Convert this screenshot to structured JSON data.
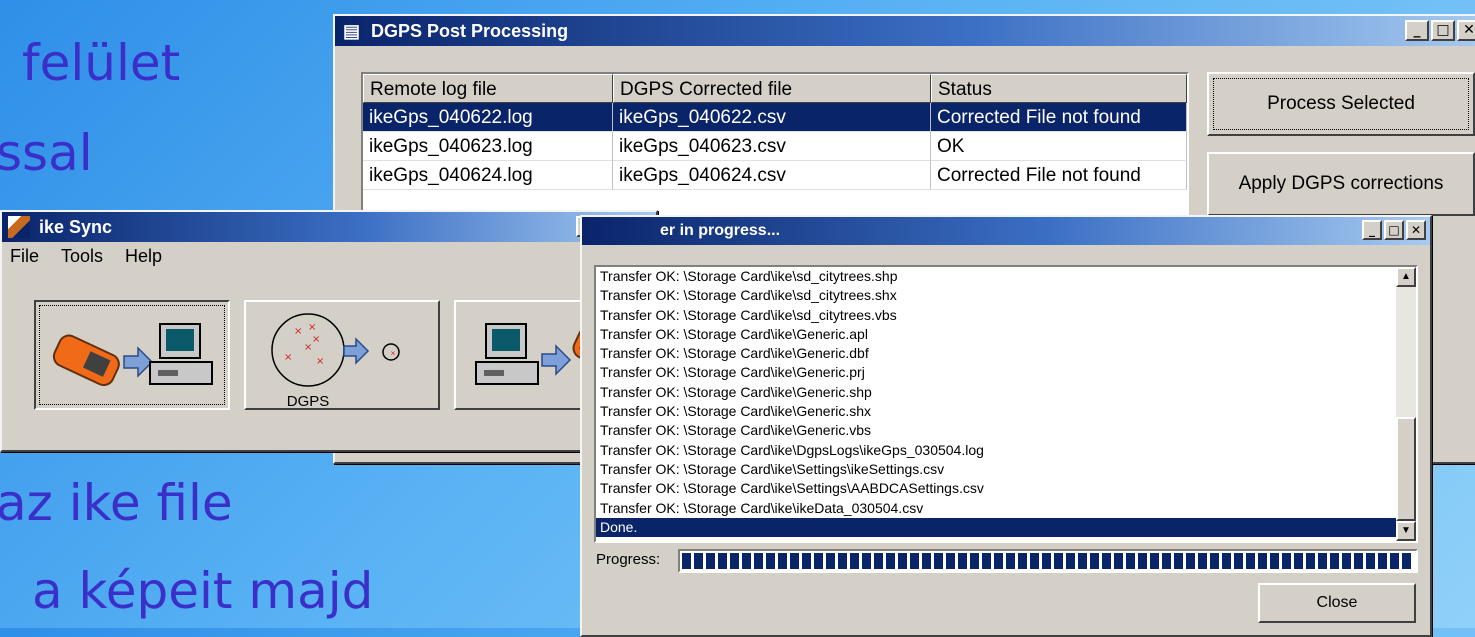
{
  "slide": {
    "line1": "felület",
    "line2": "ssal",
    "line3": "az ike file",
    "line4": "a képeit majd"
  },
  "dgps_window": {
    "title": "DGPS Post Processing",
    "columns": [
      "Remote log file",
      "DGPS Corrected file",
      "Status"
    ],
    "rows": [
      [
        "ikeGps_040622.log",
        "ikeGps_040622.csv",
        "Corrected File not found"
      ],
      [
        "ikeGps_040623.log",
        "ikeGps_040623.csv",
        "OK"
      ],
      [
        "ikeGps_040624.log",
        "ikeGps_040624.csv",
        "Corrected File not found"
      ]
    ],
    "selected_row": 0,
    "process_button": "Process Selected",
    "apply_button": "Apply DGPS corrections"
  },
  "sync_window": {
    "title": "ike Sync",
    "menu": [
      "File",
      "Tools",
      "Help"
    ],
    "dgps_label": "DGPS"
  },
  "transfer_window": {
    "title": "er in progress...",
    "log": [
      "Transfer OK: \\Storage Card\\ike\\sd_citytrees.shp",
      "Transfer OK: \\Storage Card\\ike\\sd_citytrees.shx",
      "Transfer OK: \\Storage Card\\ike\\sd_citytrees.vbs",
      "Transfer OK: \\Storage Card\\ike\\Generic.apl",
      "Transfer OK: \\Storage Card\\ike\\Generic.dbf",
      "Transfer OK: \\Storage Card\\ike\\Generic.prj",
      "Transfer OK: \\Storage Card\\ike\\Generic.shp",
      "Transfer OK: \\Storage Card\\ike\\Generic.shx",
      "Transfer OK: \\Storage Card\\ike\\Generic.vbs",
      "Transfer OK: \\Storage Card\\ike\\DgpsLogs\\ikeGps_030504.log",
      "Transfer OK: \\Storage Card\\ike\\Settings\\ikeSettings.csv",
      "Transfer OK: \\Storage Card\\ike\\Settings\\AABDCASettings.csv",
      "Transfer OK: \\Storage Card\\ike\\ikeData_030504.csv",
      "Done."
    ],
    "progress_label": "Progress:",
    "progress_value": 1.0,
    "close_button": "Close"
  },
  "colors": {
    "slide_text": "#3a2fc8",
    "titlebar": "#0a246a",
    "selection": "#0a246a",
    "window_face": "#d4d0c8"
  },
  "icons": [
    "window-icon",
    "ike-logo-icon",
    "minimize-icon",
    "maximize-icon",
    "close-icon",
    "scroll-up-icon",
    "scroll-down-icon"
  ]
}
